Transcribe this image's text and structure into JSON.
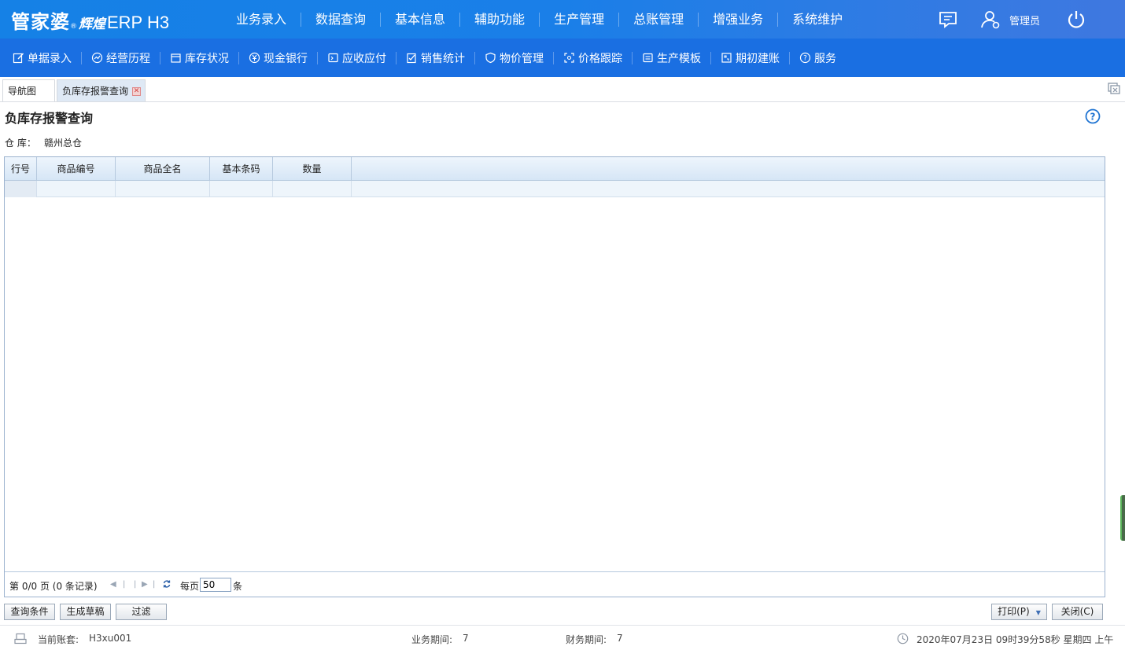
{
  "app": {
    "logo_main": "管家婆",
    "logo_reg": "®",
    "logo_sub": "辉煌",
    "logo_erp": "ERP H3",
    "admin": "管理员"
  },
  "topnav": [
    "业务录入",
    "数据查询",
    "基本信息",
    "辅助功能",
    "生产管理",
    "总账管理",
    "增强业务",
    "系统维护"
  ],
  "subnav": [
    {
      "label": "单据录入",
      "icon": "edit-icon"
    },
    {
      "label": "经营历程",
      "icon": "chart-icon"
    },
    {
      "label": "库存状况",
      "icon": "box-icon"
    },
    {
      "label": "现金银行",
      "icon": "yen-icon"
    },
    {
      "label": "应收应付",
      "icon": "ledger-icon"
    },
    {
      "label": "销售统计",
      "icon": "stats-icon"
    },
    {
      "label": "物价管理",
      "icon": "shield-icon"
    },
    {
      "label": "价格跟踪",
      "icon": "track-icon"
    },
    {
      "label": "生产模板",
      "icon": "template-icon"
    },
    {
      "label": "期初建账",
      "icon": "book-icon"
    },
    {
      "label": "服务",
      "icon": "help-icon"
    }
  ],
  "tabs": [
    {
      "label": "导航图"
    },
    {
      "label": "负库存报警查询"
    }
  ],
  "page": {
    "title": "负库存报警查询",
    "warehouse_label": "仓 库：",
    "warehouse_value": "赣州总仓"
  },
  "grid": {
    "columns": [
      "行号",
      "商品编号",
      "商品全名",
      "基本条码",
      "数量"
    ],
    "rows": []
  },
  "pager": {
    "info": "第 0/0 页 (0 条记录)",
    "per_page_label": "每页",
    "per_page_value": "50",
    "per_page_unit": "条"
  },
  "buttons": {
    "query": "查询条件",
    "draft": "生成草稿",
    "filter": "过滤",
    "print": "打印(P)",
    "close": "关闭(C)"
  },
  "status": {
    "account_label": "当前账套:",
    "account_value": "H3xu001",
    "biz_period_label": "业务期间:",
    "biz_period_value": "7",
    "fin_period_label": "财务期间:",
    "fin_period_value": "7",
    "datetime": "2020年07月23日 09时39分58秒 星期四 上午"
  },
  "colors": {
    "topbar": "#1581e6",
    "subbar": "#1a6fe2",
    "grid_header": "#d6e6f6"
  }
}
